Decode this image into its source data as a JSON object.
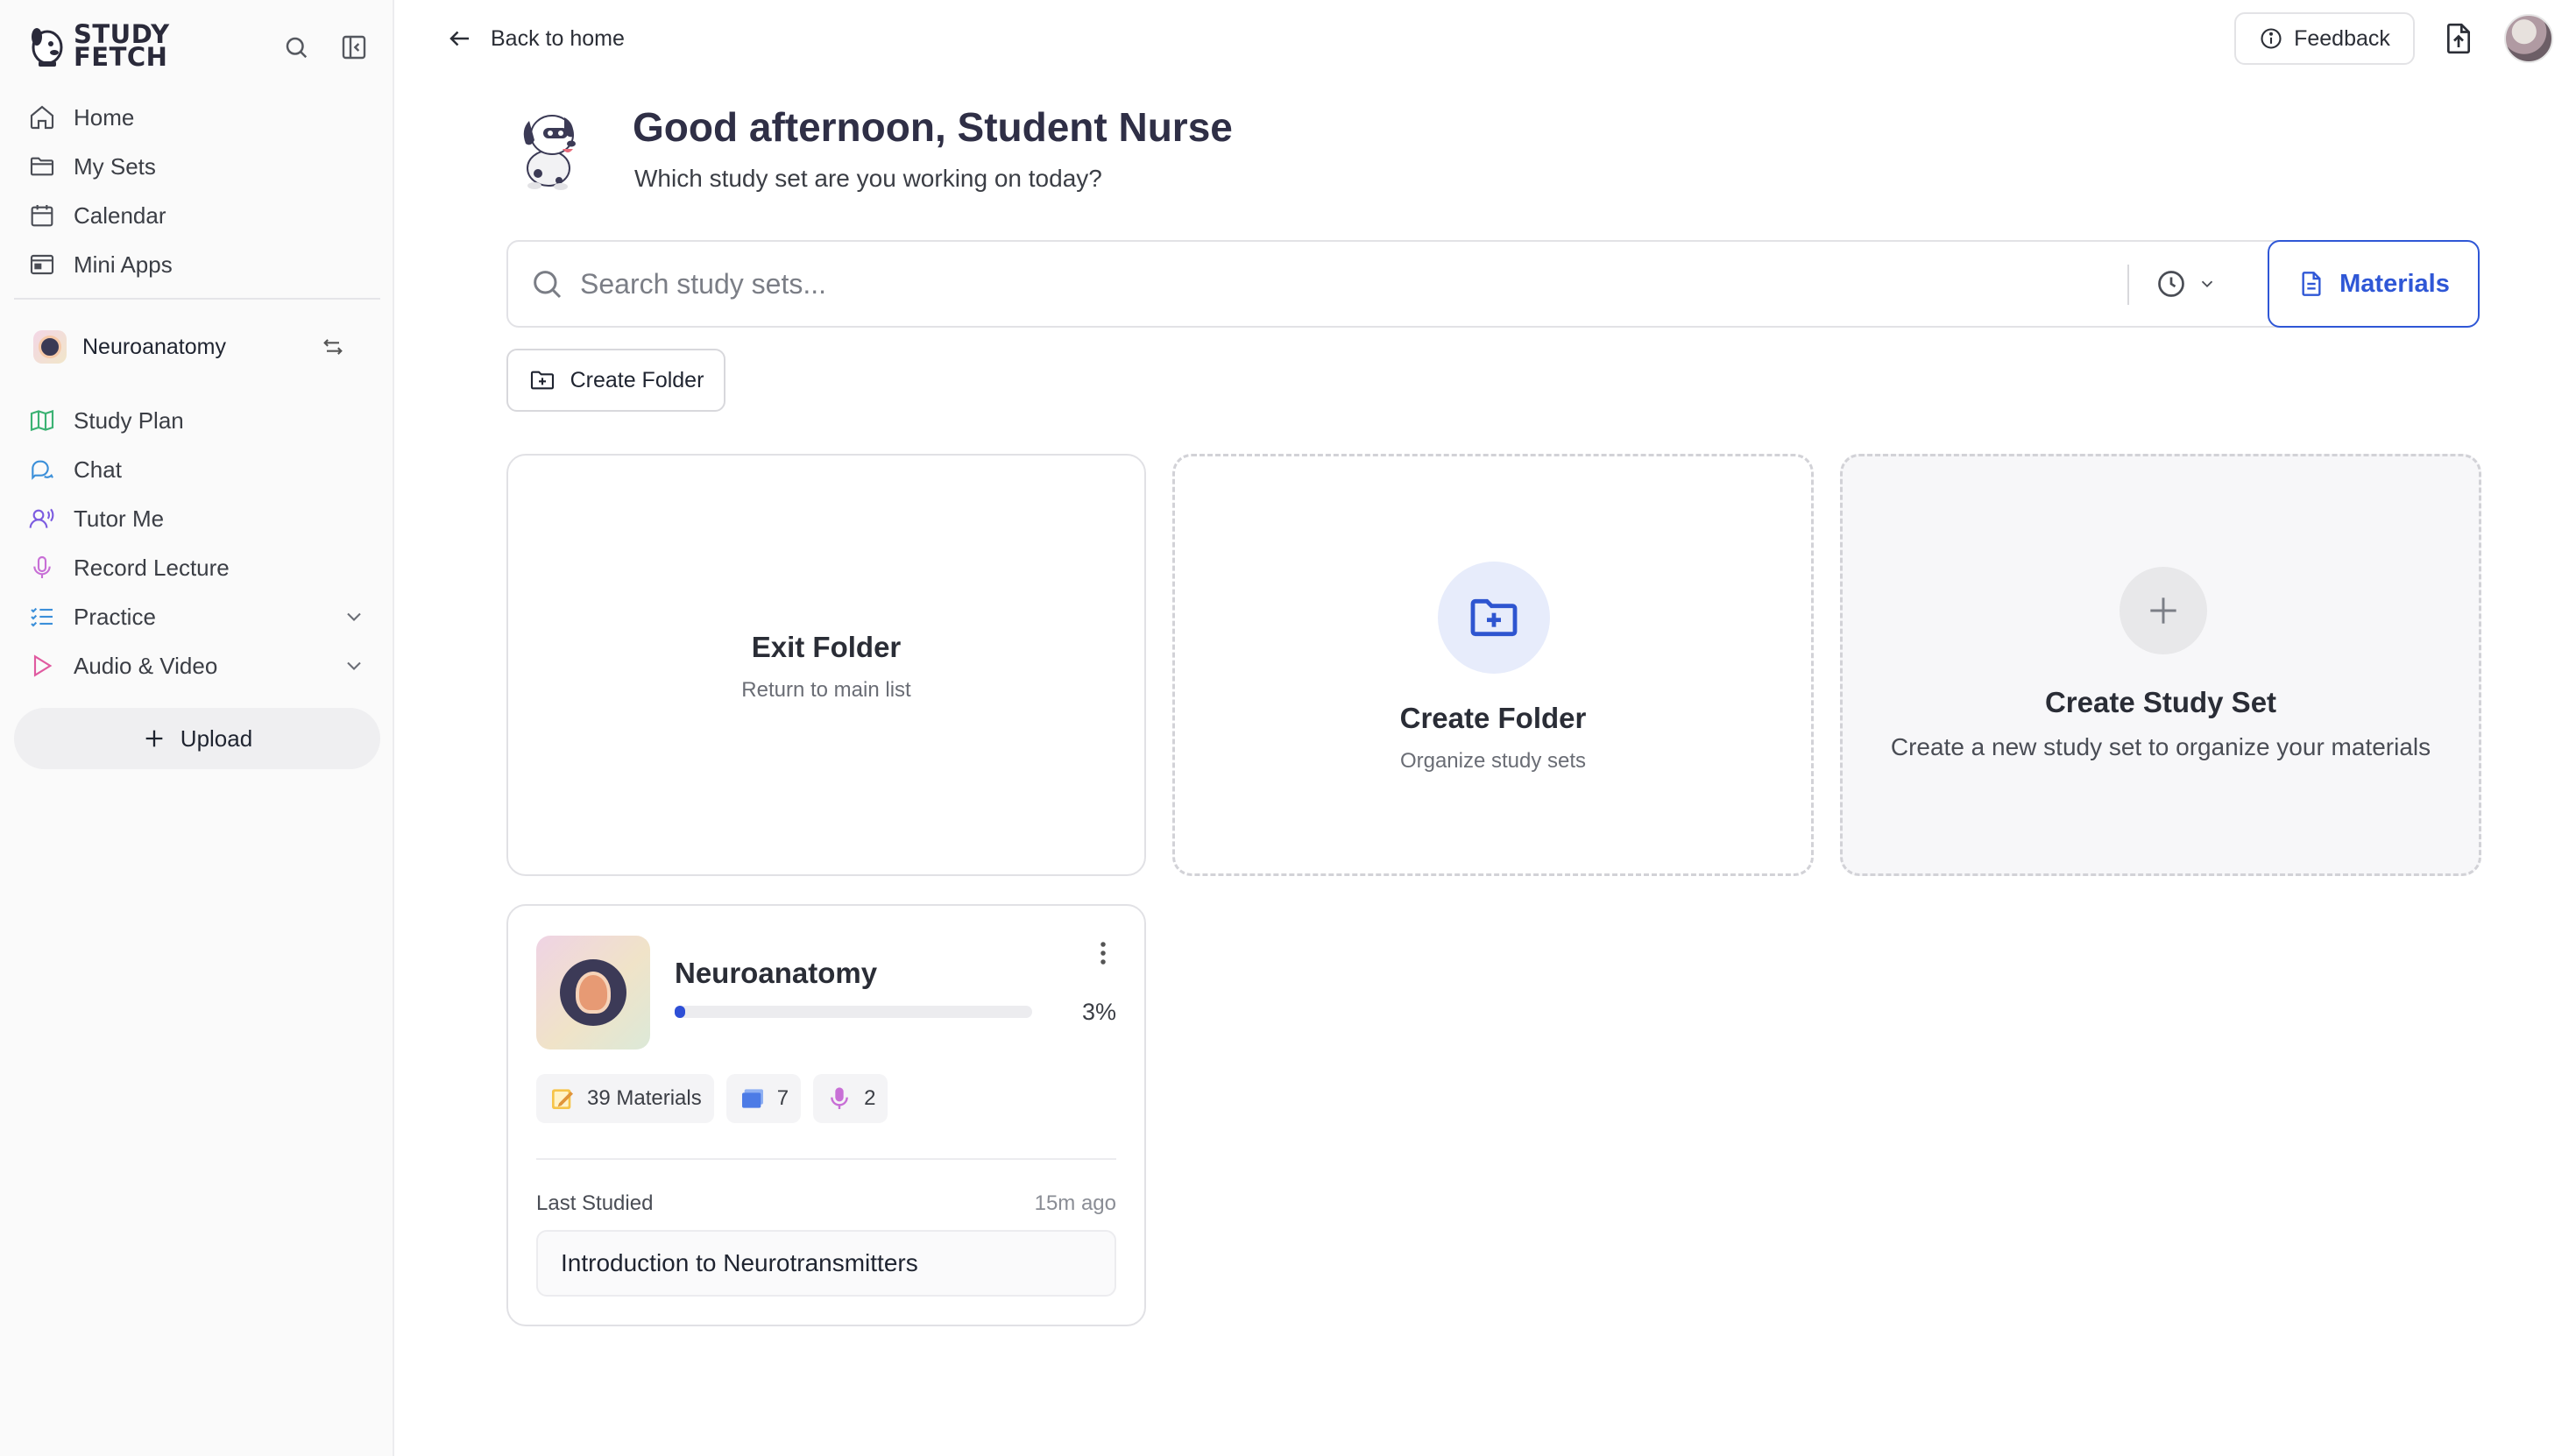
{
  "brand": {
    "line1": "STUDY",
    "line2": "FETCH"
  },
  "sidebar": {
    "nav": [
      {
        "label": "Home",
        "icon": "home-icon"
      },
      {
        "label": "My Sets",
        "icon": "folder-icon"
      },
      {
        "label": "Calendar",
        "icon": "calendar-icon"
      },
      {
        "label": "Mini Apps",
        "icon": "app-window-icon"
      }
    ],
    "current_set": {
      "label": "Neuroanatomy"
    },
    "set_nav": [
      {
        "label": "Study Plan",
        "icon": "map-icon",
        "color": "#3bb273"
      },
      {
        "label": "Chat",
        "icon": "chat-icon",
        "color": "#3b8fd9"
      },
      {
        "label": "Tutor Me",
        "icon": "tutor-icon",
        "color": "#7c5ce0"
      },
      {
        "label": "Record Lecture",
        "icon": "microphone-icon",
        "color": "#c86fd6"
      },
      {
        "label": "Practice",
        "icon": "checklist-icon",
        "color": "#3b8fd9"
      },
      {
        "label": "Audio & Video",
        "icon": "play-icon",
        "color": "#e05aa0"
      }
    ],
    "upload_label": "Upload"
  },
  "header": {
    "back_label": "Back to home",
    "feedback_label": "Feedback"
  },
  "main": {
    "greeting": "Good afternoon, Student Nurse",
    "subgreeting": "Which study set are you working on today?",
    "search_placeholder": "Search study sets...",
    "materials_label": "Materials",
    "create_folder_label": "Create Folder",
    "cards": {
      "exit": {
        "title": "Exit Folder",
        "subtitle": "Return to main list"
      },
      "new_folder": {
        "title": "Create Folder",
        "subtitle": "Organize study sets"
      },
      "new_set": {
        "title": "Create Study Set",
        "subtitle": "Create a new study set to organize your materials"
      }
    },
    "study_set": {
      "title": "Neuroanatomy",
      "progress": 3,
      "progress_label": "3%",
      "chips": [
        {
          "label": "39 Materials",
          "icon": "notes-icon"
        },
        {
          "label": "7",
          "icon": "flashcards-icon"
        },
        {
          "label": "2",
          "icon": "microphone-icon"
        }
      ],
      "last_studied_label": "Last Studied",
      "last_studied_time": "15m ago",
      "last_item": "Introduction to Neurotransmitters"
    }
  },
  "colors": {
    "accent": "#2f57d6",
    "heading": "#2f2f46"
  }
}
